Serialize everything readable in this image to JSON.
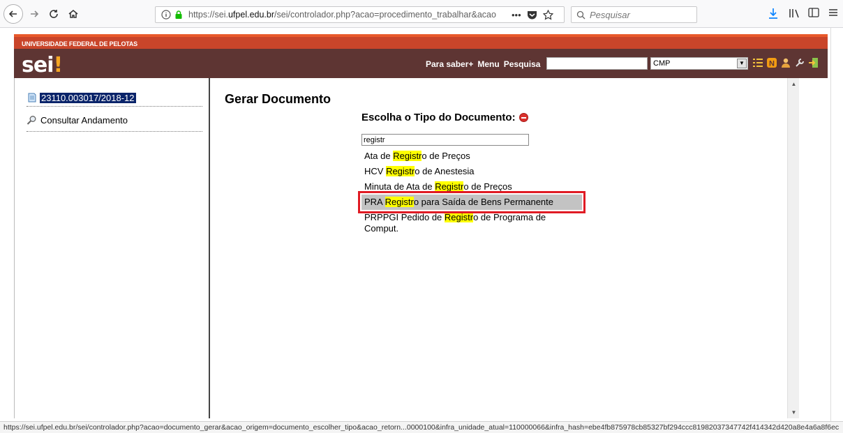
{
  "browser": {
    "url_prefix": "https://sei.",
    "url_domain": "ufpel.edu.br",
    "url_suffix": "/sei/controlador.php?acao=procedimento_trabalhar&acao",
    "search_placeholder": "Pesquisar",
    "status_url": "https://sei.ufpel.edu.br/sei/controlador.php?acao=documento_gerar&acao_origem=documento_escolher_tipo&acao_retorn...0000100&infra_unidade_atual=110000066&infra_hash=ebe4fb875978cb85327bf294ccc81982037347742f414342d420a8e4a6a8f6ec"
  },
  "header": {
    "org_name": "UNIVERSIDADE FEDERAL DE PELOTAS",
    "logo_text": "sei",
    "logo_mark": "!",
    "links": [
      "Para saber+",
      "Menu",
      "Pesquisa"
    ],
    "unit_value": "CMP",
    "accent_color": "#5e3533",
    "org_bar_color": "#c9452a"
  },
  "sidebar": {
    "process_number": "23110.003017/2018-12",
    "consult_label": "Consultar Andamento"
  },
  "main": {
    "page_title": "Gerar Documento",
    "choose_label": "Escolha o Tipo do Documento:",
    "filter_value": "registr",
    "items": [
      {
        "pre": "Ata de ",
        "hl": "Registr",
        "post": "o de Preços"
      },
      {
        "pre": "HCV ",
        "hl": "Registr",
        "post": "o de Anestesia"
      },
      {
        "pre": "Minuta de Ata de ",
        "hl": "Registr",
        "post": "o de Preços"
      },
      {
        "pre": "PRA ",
        "hl": "Registr",
        "post": "o para Saída de Bens Permanente"
      },
      {
        "pre": "PRPPGI Pedido de ",
        "hl": "Registr",
        "post": "o de Programa de Comput."
      }
    ],
    "selected_index": 3
  }
}
